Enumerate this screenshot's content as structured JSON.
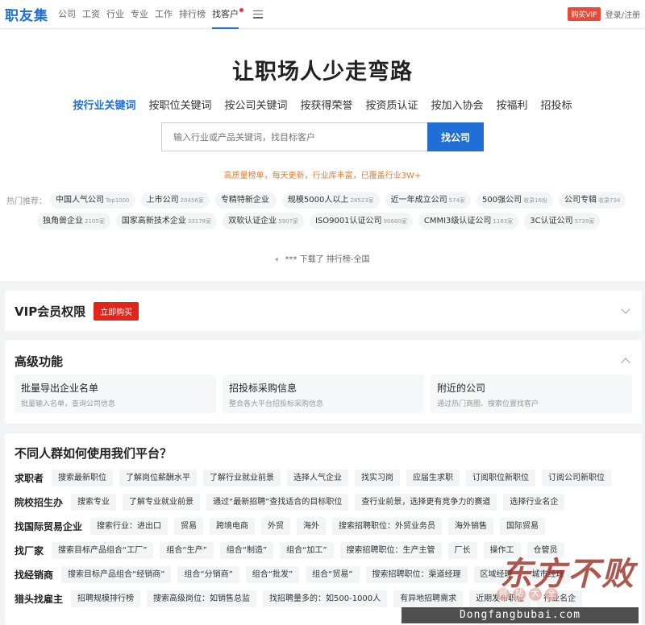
{
  "nav": {
    "logo": "职友集",
    "items": [
      "公司",
      "工资",
      "行业",
      "专业",
      "工作",
      "排行榜",
      "找客户"
    ],
    "buy_vip": "购买VIP",
    "login": "登录/注册"
  },
  "hero": {
    "title": "让职场人少走弯路",
    "tabs": [
      "按行业关键词",
      "按职位关键词",
      "按公司关键词",
      "按获得荣誉",
      "按资质认证",
      "按加入协会",
      "按福利",
      "招投标"
    ],
    "search_placeholder": "输入行业或产品关键词，找目标客户",
    "search_button": "找公司",
    "slogan": "高质量榜单，每天更新，行业库丰富，已覆盖行业3W+",
    "hot_label": "热门推荐：",
    "hot_row1": [
      {
        "name": "中国人气公司",
        "count": "Top1000"
      },
      {
        "name": "上市公司",
        "count": "20456家"
      },
      {
        "name": "专精特新企业",
        "count": ""
      },
      {
        "name": "规模5000人以上",
        "count": "28523家"
      },
      {
        "name": "近一年成立公司",
        "count": "574家"
      },
      {
        "name": "500强公司",
        "count": "收录16份"
      },
      {
        "name": "公司专辑",
        "count": "收录734"
      }
    ],
    "hot_row2": [
      {
        "name": "独角兽企业",
        "count": "2105家"
      },
      {
        "name": "国家高新技术企业",
        "count": "33178家"
      },
      {
        "name": "双软认证企业",
        "count": "5907家"
      },
      {
        "name": "ISO9001认证公司",
        "count": "90680家"
      },
      {
        "name": "CMMI3级认证公司",
        "count": "1163家"
      },
      {
        "name": "3C认证公司",
        "count": "5739家"
      }
    ],
    "ticker": "*** 下载了 排行榜-全国"
  },
  "vip": {
    "title": "VIP会员权限",
    "buy": "立即购买"
  },
  "advanced": {
    "title": "高级功能",
    "features": [
      {
        "title": "批量导出企业名单",
        "desc": "批量输入名单，查询公司信息"
      },
      {
        "title": "招投标采购信息",
        "desc": "整合各大平台招投标采购信息"
      },
      {
        "title": "附近的公司",
        "desc": "通过热门商圈、搜索位置找客户"
      }
    ]
  },
  "who": {
    "title": "不同人群如何使用我们平台？",
    "rows": [
      {
        "label": "求职者",
        "tags": [
          "搜索最新职位",
          "了解岗位薪酬水平",
          "了解行业就业前景",
          "选择人气企业",
          "找实习岗",
          "应届生求职",
          "订阅职位新职位",
          "订阅公司新职位"
        ]
      },
      {
        "label": "院校招生办",
        "tags": [
          "搜索专业",
          "了解专业就业前景",
          "通过“最新招聘”查找适合的目标职位",
          "查行业前景，选择更有竞争力的赛道",
          "选择行业名企"
        ]
      },
      {
        "label": "找国际贸易企业",
        "tags": [
          "搜索行业：进出口",
          "贸易",
          "跨境电商",
          "外贸",
          "海外",
          "搜索招聘职位：外贸业务员",
          "海外销售",
          "国际贸易"
        ]
      },
      {
        "label": "找厂家",
        "tags": [
          "搜索目标产品组合“工厂”",
          "组合“生产”",
          "组合“制造”",
          "组合“加工”",
          "搜索招聘职位：生产主管",
          "厂长",
          "操作工",
          "仓管员"
        ]
      },
      {
        "label": "找经销商",
        "tags": [
          "搜索目标产品组合“经销商”",
          "组合“分销商”",
          "组合“批发”",
          "组合“贸易”",
          "搜索招聘职位：渠道经理",
          "区域经理",
          "城市经理"
        ]
      },
      {
        "label": "猎头找雇主",
        "tags": [
          "招聘规模排行榜",
          "搜索高级岗位：如销售总监",
          "找招聘量多的：如500-1000人",
          "有异地招聘需求",
          "近期发布职位",
          "行业名企"
        ]
      }
    ]
  },
  "watermark": {
    "brand": "东方不败",
    "sub": [
      "网",
      "站",
      "大",
      "全"
    ],
    "url": "Dongfangbubai.com"
  }
}
